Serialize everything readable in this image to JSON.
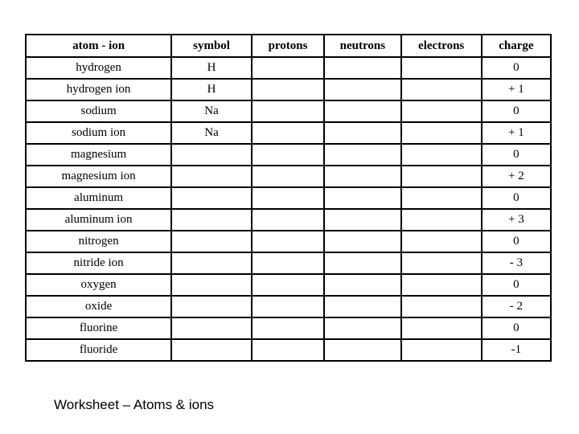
{
  "worksheet": {
    "title": "Worksheet – Atoms & ions",
    "columns": [
      "atom - ion",
      "symbol",
      "protons",
      "neutrons",
      "electrons",
      "charge"
    ],
    "rows": [
      {
        "name": "hydrogen",
        "symbol": "H",
        "protons": "",
        "neutrons": "",
        "electrons": "",
        "charge": "0"
      },
      {
        "name": "hydrogen ion",
        "symbol": "H",
        "protons": "",
        "neutrons": "",
        "electrons": "",
        "charge": "+ 1"
      },
      {
        "name": "sodium",
        "symbol": "Na",
        "protons": "",
        "neutrons": "",
        "electrons": "",
        "charge": "0"
      },
      {
        "name": "sodium ion",
        "symbol": "Na",
        "protons": "",
        "neutrons": "",
        "electrons": "",
        "charge": "+ 1"
      },
      {
        "name": "magnesium",
        "symbol": "",
        "protons": "",
        "neutrons": "",
        "electrons": "",
        "charge": "0"
      },
      {
        "name": "magnesium ion",
        "symbol": "",
        "protons": "",
        "neutrons": "",
        "electrons": "",
        "charge": "+ 2"
      },
      {
        "name": "aluminum",
        "symbol": "",
        "protons": "",
        "neutrons": "",
        "electrons": "",
        "charge": "0"
      },
      {
        "name": "aluminum ion",
        "symbol": "",
        "protons": "",
        "neutrons": "",
        "electrons": "",
        "charge": "+ 3"
      },
      {
        "name": "nitrogen",
        "symbol": "",
        "protons": "",
        "neutrons": "",
        "electrons": "",
        "charge": "0"
      },
      {
        "name": "nitride ion",
        "symbol": "",
        "protons": "",
        "neutrons": "",
        "electrons": "",
        "charge": "- 3"
      },
      {
        "name": "oxygen",
        "symbol": "",
        "protons": "",
        "neutrons": "",
        "electrons": "",
        "charge": "0"
      },
      {
        "name": "oxide",
        "symbol": "",
        "protons": "",
        "neutrons": "",
        "electrons": "",
        "charge": "- 2"
      },
      {
        "name": "fluorine",
        "symbol": "",
        "protons": "",
        "neutrons": "",
        "electrons": "",
        "charge": "0"
      },
      {
        "name": "fluoride",
        "symbol": "",
        "protons": "",
        "neutrons": "",
        "electrons": "",
        "charge": "-1"
      }
    ]
  }
}
